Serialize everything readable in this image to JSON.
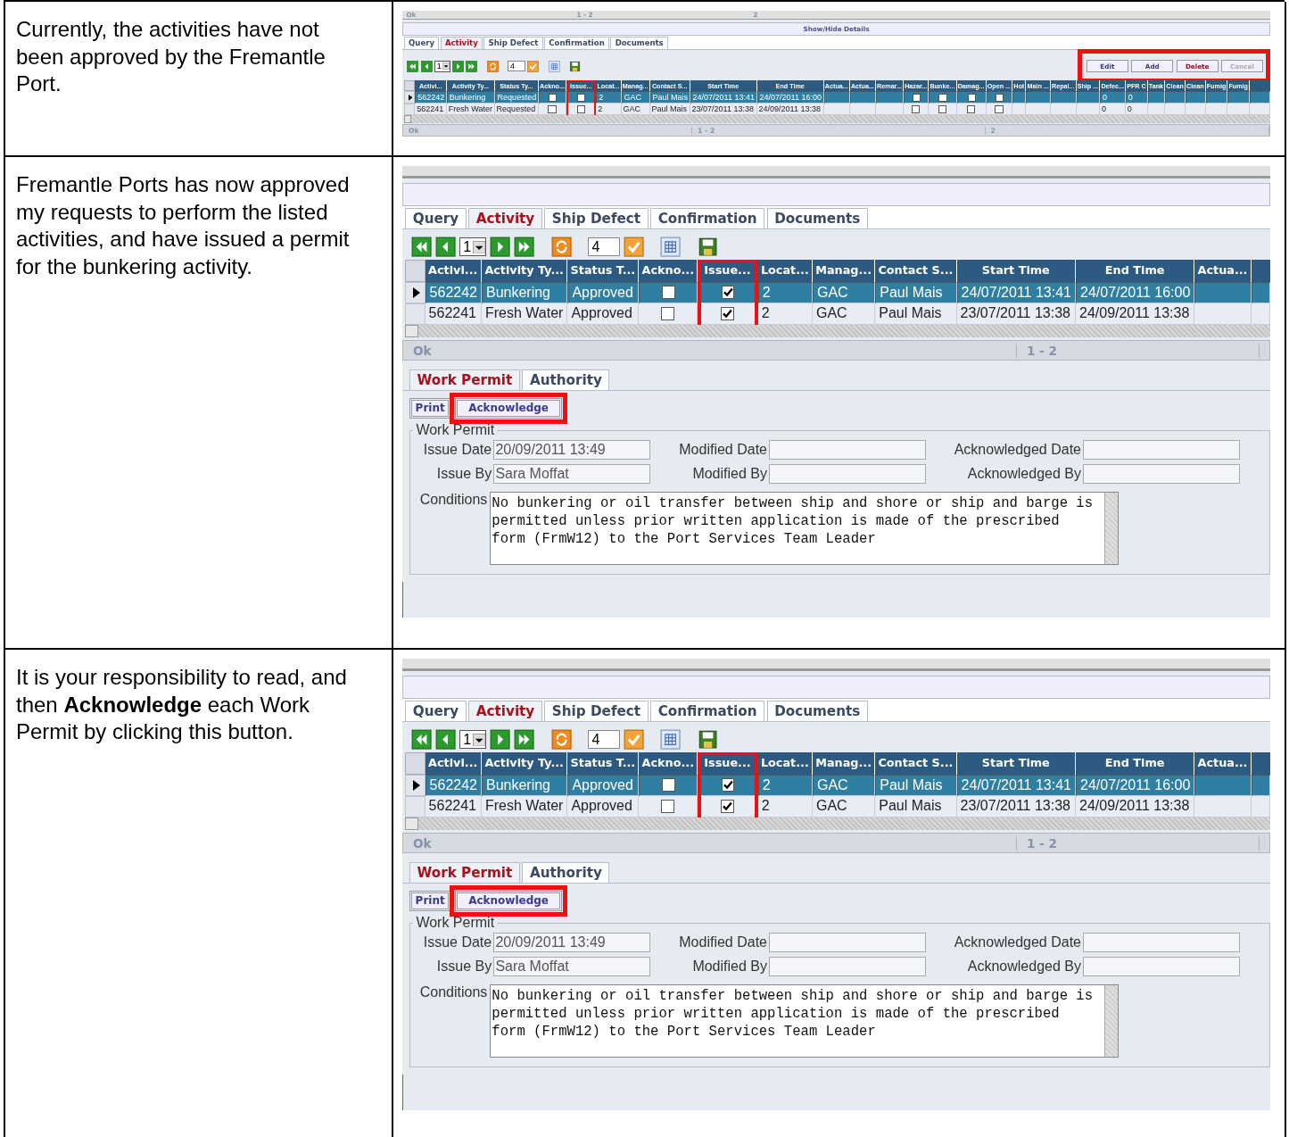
{
  "steps": [
    {
      "instruction": "Currently, the activities have not been approved by the Fremantle Port.",
      "screenshot": {
        "kind": "thumbnail",
        "top_strip": [
          "Ok",
          "1 - 2",
          "2"
        ],
        "details_label": "Show/Hide Details",
        "tabs": [
          {
            "label": "Query",
            "selected": false
          },
          {
            "label": "Activity",
            "selected": true
          },
          {
            "label": "Ship Defect",
            "selected": false
          },
          {
            "label": "Confirmation",
            "selected": false
          },
          {
            "label": "Documents",
            "selected": false
          }
        ],
        "page": "1",
        "count": "4",
        "action_buttons": {
          "highlighted": true,
          "buttons": [
            {
              "label": "Edit",
              "kind": "normal"
            },
            {
              "label": "Add",
              "kind": "normal"
            },
            {
              "label": "Delete",
              "kind": "danger"
            },
            {
              "label": "Cancel",
              "kind": "disabled"
            }
          ]
        },
        "columns": [
          {
            "label": "Activi...",
            "highlighted": false
          },
          {
            "label": "Activity Ty...",
            "highlighted": false
          },
          {
            "label": "Status Ty...",
            "highlighted": false
          },
          {
            "label": "Ackno...",
            "highlighted": false
          },
          {
            "label": "Issue...",
            "highlighted": true
          },
          {
            "label": "Locat...",
            "highlighted": false
          },
          {
            "label": "Manag...",
            "highlighted": false
          },
          {
            "label": "Contact S...",
            "highlighted": false
          },
          {
            "label": "Start Time",
            "highlighted": false
          },
          {
            "label": "End Time",
            "highlighted": false
          },
          {
            "label": "Actua...",
            "highlighted": false
          },
          {
            "label": "Actua...",
            "highlighted": false
          },
          {
            "label": "Remar...",
            "highlighted": false
          },
          {
            "label": "Hazar...",
            "highlighted": false
          },
          {
            "label": "Bunke...",
            "highlighted": false
          },
          {
            "label": "Damag...",
            "highlighted": false
          },
          {
            "label": "Open ...",
            "highlighted": false
          },
          {
            "label": "Hot",
            "highlighted": false
          },
          {
            "label": "Main ...",
            "highlighted": false
          },
          {
            "label": "Repai...",
            "highlighted": false
          },
          {
            "label": "Ship ...",
            "highlighted": false
          },
          {
            "label": "Defec...",
            "highlighted": false
          },
          {
            "label": "PFR C",
            "highlighted": false
          },
          {
            "label": "Tank",
            "highlighted": false
          },
          {
            "label": "Clean",
            "highlighted": false
          },
          {
            "label": "Clean",
            "highlighted": false
          },
          {
            "label": "Fumig",
            "highlighted": false
          },
          {
            "label": "Fumig",
            "highlighted": false
          }
        ],
        "rows": [
          {
            "selected": true,
            "cells": [
              "562242",
              "Bunkering",
              "Requested",
              false,
              false,
              "2",
              "GAC",
              "Paul Mais",
              "24/07/2011 13:41",
              "24/07/2011 16:00",
              null,
              null,
              null,
              false,
              false,
              false,
              false,
              null,
              null,
              null,
              null,
              "0",
              "0",
              null,
              null,
              null,
              null,
              null
            ]
          },
          {
            "selected": false,
            "cells": [
              "562241",
              "Fresh Water",
              "Requested",
              false,
              false,
              "2",
              "GAC",
              "Paul Mais",
              "23/07/2011 13:38",
              "24/09/2011 13:38",
              null,
              null,
              null,
              false,
              false,
              false,
              false,
              null,
              null,
              null,
              null,
              "0",
              "0",
              null,
              null,
              null,
              null,
              null
            ]
          }
        ],
        "status": [
          "Ok",
          "1 - 2",
          "2"
        ]
      }
    },
    {
      "instruction": "Fremantle Ports has now approved my requests to perform the listed activities, and have issued a permit for the bunkering activity.",
      "screenshot": {
        "kind": "full",
        "tabs": [
          {
            "label": "Query",
            "selected": false
          },
          {
            "label": "Activity",
            "selected": true
          },
          {
            "label": "Ship Defect",
            "selected": false
          },
          {
            "label": "Confirmation",
            "selected": false
          },
          {
            "label": "Documents",
            "selected": false
          }
        ],
        "page": "1",
        "count": "4",
        "columns": [
          {
            "label": "Activi...",
            "highlighted": false
          },
          {
            "label": "Activity Ty...",
            "highlighted": false
          },
          {
            "label": "Status T...",
            "highlighted": false
          },
          {
            "label": "Ackno...",
            "highlighted": false
          },
          {
            "label": "Issue...",
            "highlighted": true
          },
          {
            "label": "Locat...",
            "highlighted": false
          },
          {
            "label": "Manag...",
            "highlighted": false
          },
          {
            "label": "Contact S...",
            "highlighted": false
          },
          {
            "label": "Start Time",
            "highlighted": false
          },
          {
            "label": "End Time",
            "highlighted": false
          },
          {
            "label": "Actua...",
            "highlighted": false
          }
        ],
        "rows": [
          {
            "selected": true,
            "cells": [
              "562242",
              "Bunkering",
              "Approved",
              false,
              true,
              "2",
              "GAC",
              "Paul Mais",
              "24/07/2011 13:41",
              "24/07/2011 16:00",
              null
            ]
          },
          {
            "selected": false,
            "cells": [
              "562241",
              "Fresh Water",
              "Approved",
              false,
              true,
              "2",
              "GAC",
              "Paul Mais",
              "23/07/2011 13:38",
              "24/09/2011 13:38",
              null
            ]
          }
        ],
        "status": [
          "Ok",
          "1 - 2"
        ],
        "work_permit": {
          "subtabs": [
            {
              "label": "Work Permit",
              "selected": true
            },
            {
              "label": "Authority",
              "selected": false
            }
          ],
          "buttons": [
            {
              "label": "Print",
              "highlighted": false
            },
            {
              "label": "Acknowledge",
              "highlighted": true
            }
          ],
          "group_title": "Work Permit",
          "fields": [
            {
              "label": "Issue Date",
              "value": "20/09/2011 13:49"
            },
            {
              "label": "Modified Date"
            },
            {
              "label": "Acknowledged Date"
            },
            {
              "label": "Issue By",
              "value": "Sara Moffat"
            },
            {
              "label": "Modified By"
            },
            {
              "label": "Acknowledged By"
            }
          ],
          "conditions": {
            "label": "Conditions",
            "value": "No bunkering or oil transfer between ship and shore or ship and barge is permitted unless prior written application is made of the prescribed form (FrmW12) to the Port Services Team Leader"
          }
        }
      }
    },
    {
      "instruction": "It is your responsibility to read, and then **Acknowledge** each Work Permit by clicking this button.",
      "screenshot": {
        "kind": "full",
        "tabs": [
          {
            "label": "Query",
            "selected": false
          },
          {
            "label": "Activity",
            "selected": true
          },
          {
            "label": "Ship Defect",
            "selected": false
          },
          {
            "label": "Confirmation",
            "selected": false
          },
          {
            "label": "Documents",
            "selected": false
          }
        ],
        "page": "1",
        "count": "4",
        "columns": [
          {
            "label": "Activi...",
            "highlighted": false
          },
          {
            "label": "Activity Ty...",
            "highlighted": false
          },
          {
            "label": "Status T...",
            "highlighted": false
          },
          {
            "label": "Ackno...",
            "highlighted": false
          },
          {
            "label": "Issue...",
            "highlighted": true
          },
          {
            "label": "Locat...",
            "highlighted": false
          },
          {
            "label": "Manag...",
            "highlighted": false
          },
          {
            "label": "Contact S...",
            "highlighted": false
          },
          {
            "label": "Start Time",
            "highlighted": false
          },
          {
            "label": "End Time",
            "highlighted": false
          },
          {
            "label": "Actua...",
            "highlighted": false
          }
        ],
        "rows": [
          {
            "selected": true,
            "cells": [
              "562242",
              "Bunkering",
              "Approved",
              false,
              true,
              "2",
              "GAC",
              "Paul Mais",
              "24/07/2011 13:41",
              "24/07/2011 16:00",
              null
            ]
          },
          {
            "selected": false,
            "cells": [
              "562241",
              "Fresh Water",
              "Approved",
              false,
              true,
              "2",
              "GAC",
              "Paul Mais",
              "23/07/2011 13:38",
              "24/09/2011 13:38",
              null
            ]
          }
        ],
        "status": [
          "Ok",
          "1 - 2"
        ],
        "work_permit": {
          "subtabs": [
            {
              "label": "Work Permit",
              "selected": true
            },
            {
              "label": "Authority",
              "selected": false
            }
          ],
          "buttons": [
            {
              "label": "Print",
              "highlighted": false
            },
            {
              "label": "Acknowledge",
              "highlighted": true
            }
          ],
          "group_title": "Work Permit",
          "fields": [
            {
              "label": "Issue Date",
              "value": "20/09/2011 13:49"
            },
            {
              "label": "Modified Date"
            },
            {
              "label": "Acknowledged Date"
            },
            {
              "label": "Issue By",
              "value": "Sara Moffat"
            },
            {
              "label": "Modified By"
            },
            {
              "label": "Acknowledged By"
            }
          ],
          "conditions": {
            "label": "Conditions",
            "value": "No bunkering or oil transfer between ship and shore or ship and barge is permitted unless prior written application is made of the prescribed form (FrmW12) to the Port Services Team Leader"
          }
        }
      }
    }
  ]
}
